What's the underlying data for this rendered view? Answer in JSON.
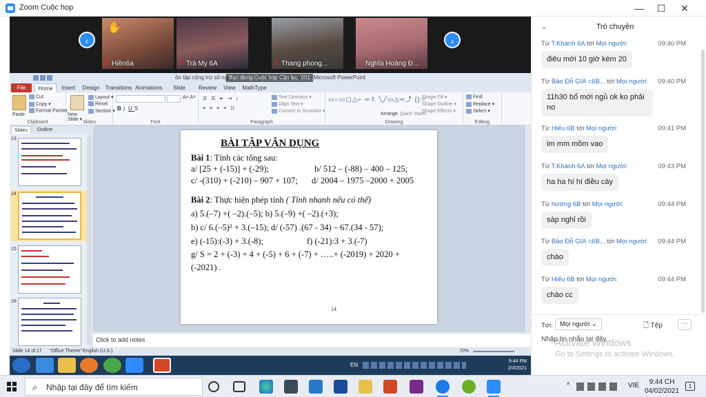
{
  "window": {
    "title": "Zoom Cuộc họp",
    "minimize": "—",
    "maximize": "☐",
    "close": "✕"
  },
  "gallery": {
    "participants": [
      {
        "name": "Hiền6a"
      },
      {
        "name": "Trà My 6A"
      },
      {
        "name": "Thang phong..."
      },
      {
        "name": "Nghĩa Hoàng Đ..."
      }
    ],
    "prev": "‹",
    "next": "›"
  },
  "powerpoint": {
    "title": "ôn tập cộng trừ số nguyên - lớp 6 [Compatibility Mode] - Microsoft PowerPoint",
    "share_badge": "Bạn đang Cuộc họp Cận lạc. 001",
    "tabs": [
      "File",
      "Home",
      "Insert",
      "Design",
      "Transitions",
      "Animations",
      "Slide Show",
      "Review",
      "View",
      "MathType"
    ],
    "ribbon": {
      "clipboard": {
        "label": "Clipboard",
        "paste": "Paste",
        "cut": "Cut",
        "copy": "Copy ▾",
        "format_painter": "Format Painter"
      },
      "slides": {
        "label": "Slides",
        "new_slide": "New Slide ▾",
        "layout": "Layout ▾",
        "reset": "Reset",
        "section": "Section ▾"
      },
      "font": {
        "label": "Font"
      },
      "paragraph": {
        "label": "Paragraph",
        "text_direction": "Text Direction ▾",
        "align_text": "Align Text ▾",
        "smartart": "Convert to SmartArt ▾"
      },
      "drawing": {
        "label": "Drawing",
        "arrange": "Arrange",
        "quick_styles": "Quick Styles",
        "shape_fill": "Shape Fill ▾",
        "shape_outline": "Shape Outline ▾",
        "shape_effects": "Shape Effects ▾"
      },
      "editing": {
        "label": "Editing",
        "find": "Find",
        "replace": "Replace ▾",
        "select": "Select ▾"
      }
    },
    "slides_panel": {
      "tab_slides": "Slides",
      "tab_outline": "Outline",
      "thumbs": [
        {
          "num": "13"
        },
        {
          "num": "14"
        },
        {
          "num": "15"
        },
        {
          "num": "16"
        }
      ]
    },
    "slide": {
      "heading": "BÀI TẬP VẬN DỤNG",
      "bai1_label": "Bài 1",
      "bai1_text": ": Tính các tổng sau:",
      "l1a": "a/ [25 + (-15)] + (-29);",
      "l1b": "b/ 512 – (-88) – 400 – 125;",
      "l2a": "c/ -(310) + (-210) – 907 + 107;",
      "l2b": "d/ 2004 – 1975 –2000 + 2005",
      "bai2_label": "Bài 2",
      "bai2_text": ":  Thực hiện phép tính",
      "bai2_hint": "( Tính nhanh nếu có thể)",
      "l3": "a)   5.(–7) +( –2).(–5);  b) 5.(–9) +( –2).(+3);",
      "l4": "b)  c/  6.(–5)² + 3.(–15);        d/ (-57) .(67 - 34) – 67.(34 - 57);",
      "l5a": "e) (-15):(-3) + 3.(-8);",
      "l5b": "f) (-21):3 + 3.(-7)",
      "l6": "g/  S = 2 + (-3) + 4 + (-5) + 6 + (-7) + …..+  (-2019) + 2020 +",
      "l7": "(-2021) .",
      "number": "14"
    },
    "notes_placeholder": "Click to add notes",
    "status": {
      "slide": "Slide 14 of 17",
      "theme": "\"Office Theme\"",
      "language": "English (U.S.)",
      "zoom": "70%"
    },
    "inner_clock": {
      "time": "9:44 PM",
      "date": "2/4/2021"
    },
    "inner_lang": "EN"
  },
  "chat": {
    "title": "Trò chuyện",
    "from_word": "Từ",
    "to_word": "tới",
    "messages": [
      {
        "sender": "T.Khánh 6A",
        "target": "Mọi người:",
        "time": "09:40 PM",
        "text": "điêu mới 10 giờ kém 20"
      },
      {
        "sender": "Bảo Đỗ GIA =6B...",
        "target": "Mọi người:",
        "time": "09:40 PM",
        "text": "11h30 bổ mới ngủ ok ko phải no"
      },
      {
        "sender": "Hiếu 6B",
        "target": "Mọi người:",
        "time": "09:41 PM",
        "text": "im mm mồm vao"
      },
      {
        "sender": "T.Khánh 6A",
        "target": "Mọi người:",
        "time": "09:43 PM",
        "text": "ha ha hí hí điều cày"
      },
      {
        "sender": "hướng 6B",
        "target": "Mọi người:",
        "time": "09:44 PM",
        "text": "sáp nghỉ rồi"
      },
      {
        "sender": "Bảo Đỗ GIA =6B...",
        "target": "Mọi người:",
        "time": "09:44 PM",
        "text": "chào"
      },
      {
        "sender": "Hiếu 6B",
        "target": "Mọi người:",
        "time": "09:44 PM",
        "text": "chào cc"
      }
    ],
    "to_label": "Tới:",
    "to_value": "Mọi người ⌄",
    "file_label": "Tệp",
    "more_label": "···",
    "input_placeholder": "Nhập tin nhắn tại đây..."
  },
  "activate": {
    "line1": "Activate Windows",
    "line2": "Go to Settings to activate Windows."
  },
  "taskbar": {
    "search_placeholder": "Nhập tại đây để tìm kiếm",
    "lang": "VIE",
    "time": "9:44 CH",
    "date": "04/02/2021",
    "notif_count": "1",
    "tray_arrow": "^"
  }
}
